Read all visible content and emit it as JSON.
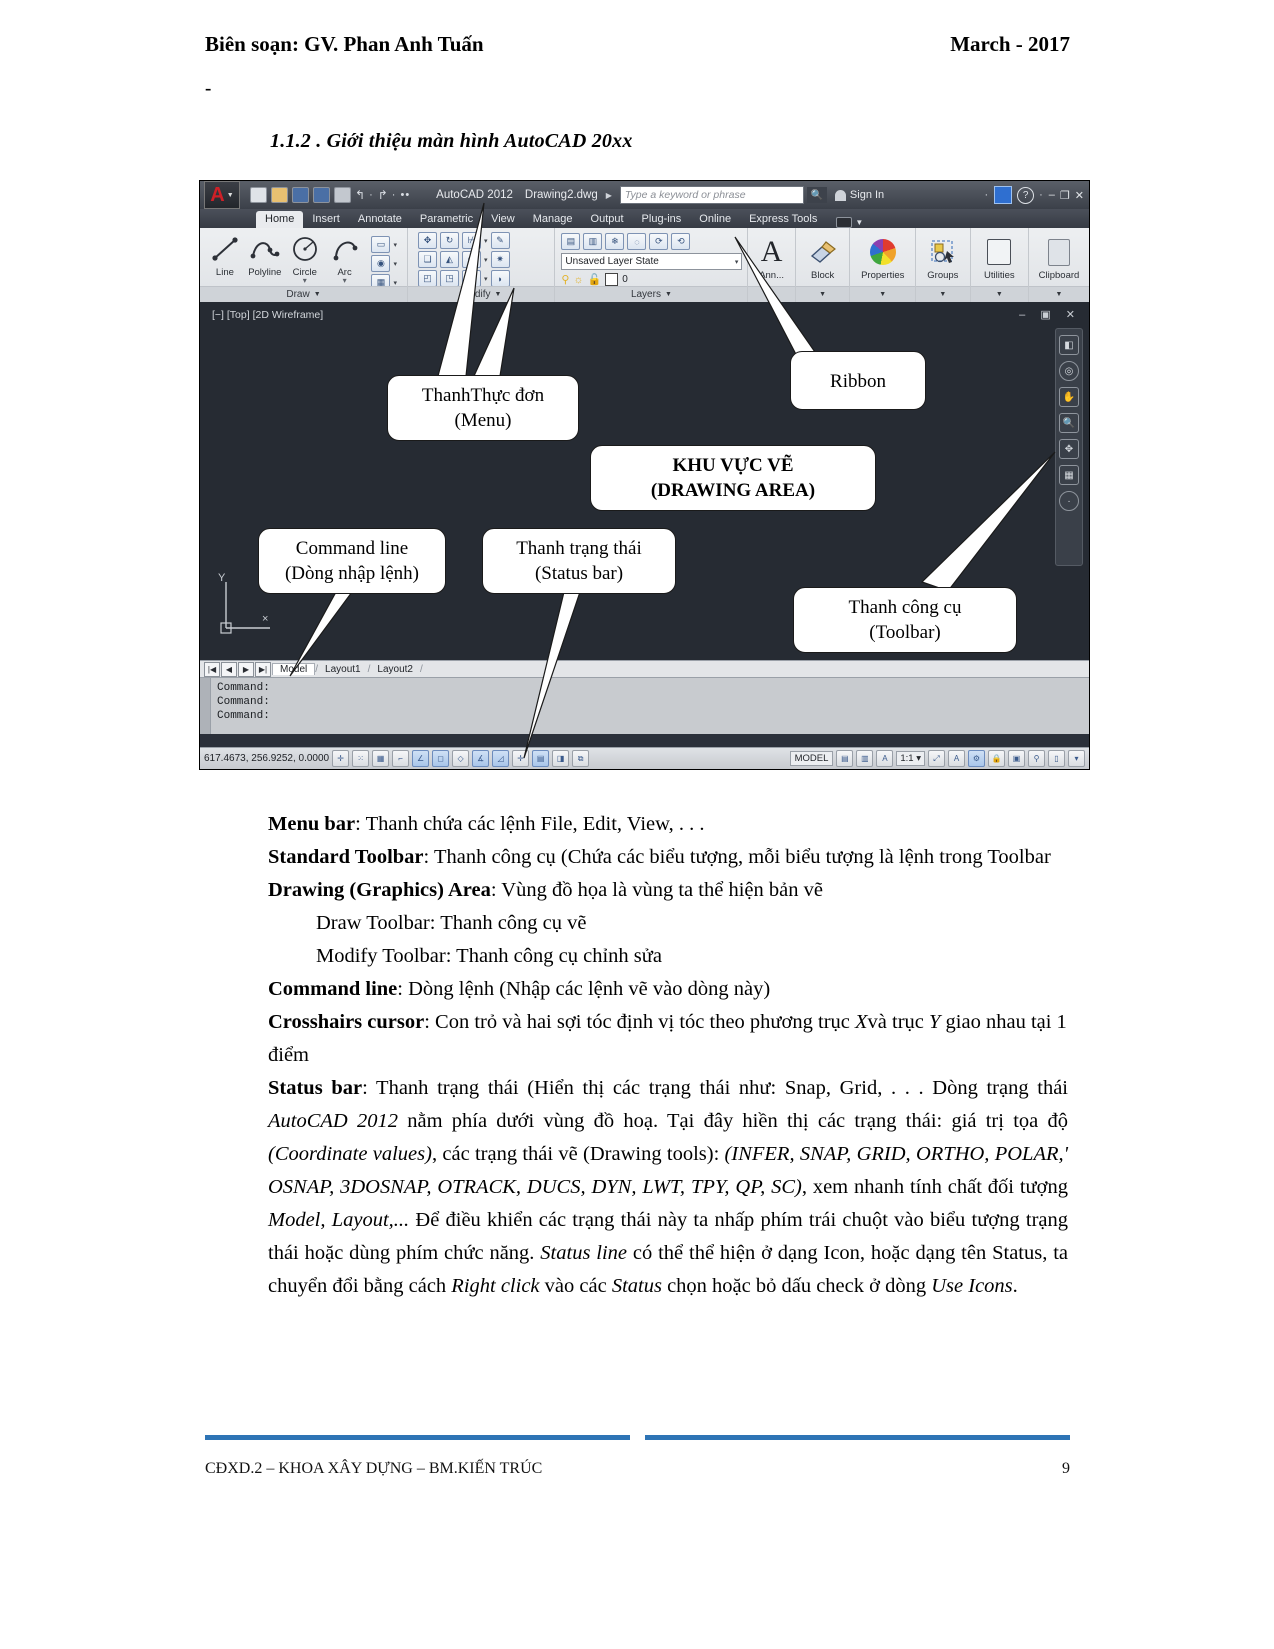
{
  "header": {
    "left": "Biên soạn: GV. Phan Anh Tuấn",
    "right": "March - 2017",
    "dash": "-"
  },
  "section_heading": "1.1.2 .  Giới thiệu màn hình AutoCAD 20xx",
  "cad": {
    "titlebar": {
      "logo_letter": "A",
      "app_title": "AutoCAD 2012",
      "doc_name": "Drawing2.dwg",
      "search_placeholder": "Type a keyword or phrase",
      "sign_in": "Sign In",
      "minimize": "–",
      "maximize": "❐",
      "close": "✕"
    },
    "tabs": [
      "Home",
      "Insert",
      "Annotate",
      "Parametric",
      "View",
      "Manage",
      "Output",
      "Plug-ins",
      "Online",
      "Express Tools"
    ],
    "active_tab": "Home",
    "ribbon": {
      "draw": {
        "label": "Draw",
        "tools": [
          "Line",
          "Polyline",
          "Circle",
          "Arc"
        ]
      },
      "modify": {
        "label": "Modify"
      },
      "layers": {
        "label": "Layers",
        "layer_state": "Unsaved Layer State",
        "current_layer": "0"
      },
      "panels": [
        "Ann...",
        "Block",
        "Properties",
        "Groups",
        "Utilities",
        "Clipboard"
      ]
    },
    "canvas": {
      "viewport_label": "[−] [Top] [2D Wireframe]",
      "ucs_y": "Y"
    },
    "layout_tabs": [
      "Model",
      "Layout1",
      "Layout2"
    ],
    "command_lines": [
      "Command:",
      "Command:",
      "Command:"
    ],
    "status": {
      "coordinates": "617.4673, 256.9252, 0.0000",
      "model_label": "MODEL",
      "scale_label": "1:1"
    }
  },
  "callouts": [
    {
      "id": "menu",
      "line1": "ThanhThực đơn",
      "line2": "(Menu)"
    },
    {
      "id": "ribbon",
      "line1": "Ribbon",
      "line2": ""
    },
    {
      "id": "drawing_area",
      "line1": "KHU VỰC VẼ",
      "line2": "(DRAWING AREA)"
    },
    {
      "id": "command_line",
      "line1": "Command line",
      "line2": "(Dòng nhập lệnh)"
    },
    {
      "id": "status_bar",
      "line1": "Thanh trạng thái",
      "line2": "(Status bar)"
    },
    {
      "id": "toolbar",
      "line1": "Thanh công cụ",
      "line2": "(Toolbar)"
    }
  ],
  "body": {
    "p1_label": "Menu bar",
    "p1_text": ": Thanh chứa các lệnh File, Edit, View, . . .",
    "p2_label": "Standard Toolbar",
    "p2_text": ": Thanh công cụ (Chứa các biểu tượng, mỗi biểu tượng là lệnh trong Toolbar",
    "p3_label": "Drawing (Graphics) Area",
    "p3_text": ": Vùng đồ họa là vùng ta thể hiện bản vẽ",
    "p4_text": "Draw Toolbar: Thanh công cụ vẽ",
    "p5_text": "Modify Toolbar: Thanh công cụ chỉnh sửa",
    "p6_label": "Command line",
    "p6_text": ": Dòng lệnh (Nhập các lệnh vẽ vào dòng này)",
    "p7_label": "Crosshairs cursor",
    "p7_text_a": ": Con trỏ và hai sợi tóc định vị tóc theo phương trục ",
    "p7_italic_x": "X",
    "p7_text_b": "và trục ",
    "p7_italic_y": "Y",
    "p7_text_c": " giao nhau tại 1 điểm",
    "p8_label": "Status bar",
    "p8_a": ": Thanh trạng thái (Hiển thị các trạng thái như: Snap, Grid, . . . Dòng trạng thái ",
    "p8_i1": "AutoCAD 2012",
    "p8_b": " nằm phía dưới vùng đồ hoạ. Tại đây hiền thị các trạng thái: giá trị tọa độ ",
    "p8_i2": "(Coordinate values)",
    "p8_c": ", các trạng thái vẽ (Drawing tools): ",
    "p8_i3": "(INFER, SNAP, GRID, ORTHO, POLAR,' OSNAP, 3DOSNAP, OTRACK, DUCS, DYN, LWT, TPY, QP, SC)",
    "p8_d": ", xem nhanh tính chất đối tượng ",
    "p8_i4": "Model, Layout,...",
    "p8_e": " Để điều khiển các trạng thái này ta nhấp phím trái chuột vào biểu tượng trạng thái hoặc dùng phím chức năng. ",
    "p8_i5": "Status line",
    "p8_f": " có thể thể hiện ở dạng Icon, hoặc dạng tên Status, ta chuyển đổi bằng cách ",
    "p8_i6": "Right click",
    "p8_g": " vào các ",
    "p8_i7": "Status",
    "p8_h": " chọn hoặc bỏ dấu check ở dòng ",
    "p8_i8": "Use Icons",
    "p8_i": "."
  },
  "footer": {
    "left": "CĐXD.2 – KHOA XÂY DỰNG – BM.KIẾN TRÚC",
    "page": "9"
  },
  "colors": {
    "accent_blue": "#2e74b5",
    "cad_canvas": "#262b33",
    "autodesk_red": "#cf2027"
  }
}
